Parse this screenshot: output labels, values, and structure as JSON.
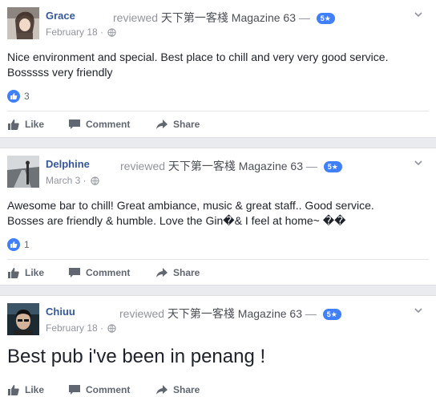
{
  "posts": [
    {
      "author": "Grace",
      "verb": "reviewed",
      "page": "天下第一客棧 Magazine 63",
      "dash": "—",
      "rating": "5★",
      "date": "February 18 ·",
      "text": "Nice environment and special. Best place to chill and very very good service. Bosssss very friendly",
      "likes": "3"
    },
    {
      "author": "Delphine",
      "verb": "reviewed",
      "page": "天下第一客棧 Magazine 63",
      "dash": "—",
      "rating": "5★",
      "date": "March 3 ·",
      "text": "Awesome bar to chill! Great ambiance, music & great staff.. Good service. Bosses are friendly & humble. Love the Gin�& I feel at home~ ��",
      "likes": "1"
    },
    {
      "author": "Chiuu",
      "verb": "reviewed",
      "page": "天下第一客棧 Magazine 63",
      "dash": "—",
      "rating": "5★",
      "date": "February 18 ·",
      "text": "Best pub i've been in penang !"
    }
  ],
  "actions": {
    "like": "Like",
    "comment": "Comment",
    "share": "Share"
  },
  "colors": {
    "link": "#365899",
    "accent": "#4080ff",
    "muted": "#90949c",
    "background": "#e9ebee"
  },
  "icons": [
    "globe-icon",
    "chevron-down-icon",
    "thumbs-up-icon",
    "comment-icon",
    "share-icon"
  ]
}
